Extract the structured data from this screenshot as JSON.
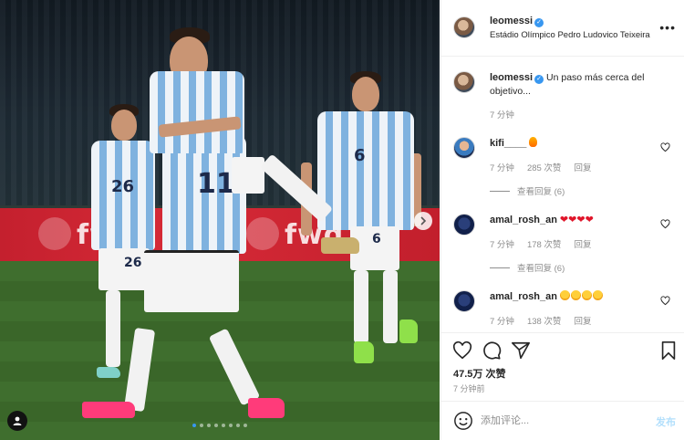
{
  "post": {
    "username": "leomessi",
    "location": "Estádio Olímpico Pedro Ludovico Teixeira",
    "more_label": "•••",
    "caption": {
      "username": "leomessi",
      "text": "Un paso más cerca del objetivo...",
      "time": "7 分钟"
    },
    "photo": {
      "ad_text_left": "fwd",
      "ad_text_right": "fwd",
      "jersey_numbers": [
        "26",
        "11",
        "6",
        "26",
        "6"
      ],
      "carousel_dots": 8,
      "active_dot": 0,
      "next_icon": "chevron-right-icon"
    },
    "comments": [
      {
        "username": "kifi____",
        "emoji": "fire",
        "time": "7 分钟",
        "likes": "285 次赞",
        "reply": "回复",
        "view_replies": "查看回复 (6)"
      },
      {
        "username": "amal_rosh_an",
        "emoji": "red-hearts",
        "time": "7 分钟",
        "likes": "178 次赞",
        "reply": "回复",
        "view_replies": "查看回复 (6)"
      },
      {
        "username": "amal_rosh_an",
        "emoji": "star-struck-faces",
        "time": "7 分钟",
        "likes": "138 次赞",
        "reply": "回复"
      }
    ],
    "likes_count": "47.5万 次赞",
    "time_ago": "7 分钟前",
    "comment_placeholder": "添加评论...",
    "post_label": "发布"
  },
  "colors": {
    "accent": "#3897f0",
    "post_button": "#b2dffc",
    "muted_text": "#8e8e8e",
    "divider": "#efefef",
    "heart_red": "#e0152a",
    "ad_board": "#c4202e"
  }
}
